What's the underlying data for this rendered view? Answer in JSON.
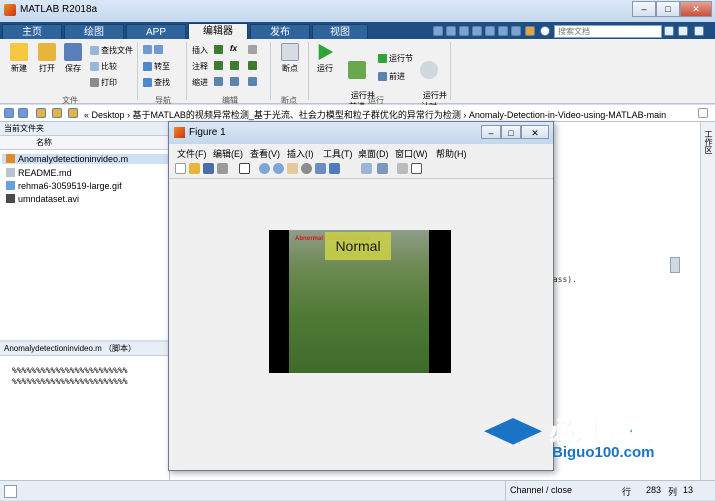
{
  "app": {
    "title": "MATLAB R2018a"
  },
  "tabs": [
    {
      "label": "主页"
    },
    {
      "label": "绘图"
    },
    {
      "label": "APP"
    },
    {
      "label": "编辑器"
    },
    {
      "label": "发布"
    },
    {
      "label": "视图"
    }
  ],
  "search": {
    "placeholder": "搜索文档"
  },
  "window_controls": {
    "minimize": "–",
    "maximize": "□",
    "close": "✕"
  },
  "ribbon": {
    "file": {
      "new": "新建",
      "open": "打开",
      "save": "保存",
      "find_file": "查找文件",
      "compare": "比较",
      "print": "打印",
      "group": "文件"
    },
    "nav": {
      "goto": "转至",
      "find": "查找",
      "group": "导航"
    },
    "edit": {
      "insert": "插入",
      "comment": "注释",
      "indent": "缩进",
      "fx": "fx",
      "group": "编辑"
    },
    "breakpoint": {
      "label": "断点",
      "group": "断点"
    },
    "run": {
      "run": "运行",
      "run_advance": "运行并\n前进",
      "run_section": "运行节",
      "advance": "前进",
      "run_time": "运行并\n计时",
      "group": "运行"
    }
  },
  "address": {
    "path": "« Desktop › 基于MATLAB的视频异常检测_基于光流、社会力模型和粒子群优化的异常行为检测 › Anomaly-Detection-in-Video-using-MATLAB-main"
  },
  "current_folder": {
    "title": "当前文件夹",
    "col_name": "名称",
    "files": [
      "Anomalydetectioninvideo.m",
      "README.md",
      "rehma6-3059519-large.gif",
      "umndataset.avi"
    ]
  },
  "details": {
    "title": "Anomalydetectioninvideo.m （脚本）",
    "lines": [
      "%%%%%%%%%%%%%%%%%%%%%%%%",
      "%%%%%%%%%%%%%%%%%%%%%%%%"
    ]
  },
  "editor": {
    "snippet": "lass)."
  },
  "figure": {
    "title": "Figure 1",
    "menu": [
      "文件(F)",
      "编辑(E)",
      "查看(V)",
      "插入(I)",
      "工具(T)",
      "桌面(D)",
      "窗口(W)",
      "帮助(H)"
    ],
    "video_label": "Normal",
    "overlay_text": "Abnormal Crowd behavior"
  },
  "status": {
    "channel": "Channel / close",
    "row_label": "行",
    "row": "283",
    "col_label": "列",
    "col": "13"
  },
  "right_dock": {
    "label": "工作区"
  },
  "watermark": {
    "cn": "必过源码",
    "en": "Biguo100.com"
  }
}
